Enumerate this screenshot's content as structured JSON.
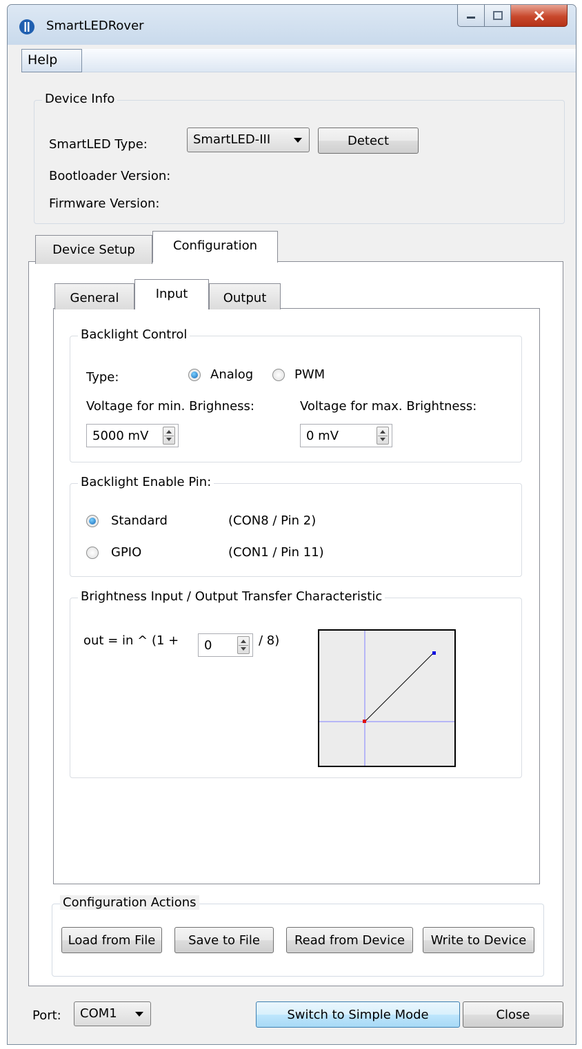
{
  "window": {
    "title": "SmartLEDRover",
    "icons": {
      "app": "app-logo-icon",
      "minimize": "minimize-icon",
      "maximize": "maximize-icon",
      "close": "close-x-icon"
    }
  },
  "menu": {
    "help": "Help"
  },
  "device_info": {
    "title": "Device Info",
    "type_label": "SmartLED Type:",
    "type_value": "SmartLED-III",
    "detect": "Detect",
    "bootloader_label": "Bootloader Version:",
    "firmware_label": "Firmware Version:"
  },
  "tabs": {
    "device_setup": "Device Setup",
    "configuration": "Configuration",
    "active": "Configuration"
  },
  "subtabs": {
    "general": "General",
    "input": "Input",
    "output": "Output",
    "active": "Input"
  },
  "backlight_control": {
    "title": "Backlight Control",
    "type_label": "Type:",
    "analog": "Analog",
    "pwm": "PWM",
    "selected": "Analog",
    "min_label": "Voltage for min. Brighness:",
    "max_label": "Voltage for max. Brightness:",
    "min_value": "5000 mV",
    "max_value": "0 mV"
  },
  "enable_pin": {
    "title": "Backlight Enable Pin:",
    "standard": "Standard",
    "standard_pin": "(CON8 / Pin 2)",
    "gpio": "GPIO",
    "gpio_pin": "(CON1 / Pin 11)",
    "selected": "Standard"
  },
  "transfer": {
    "title": "Brightness Input / Output Transfer Characteristic",
    "formula_prefix": "out = in ^ (1 +",
    "formula_suffix": "/ 8)",
    "exponent_value": "0"
  },
  "config_actions": {
    "title": "Configuration Actions",
    "load": "Load from File",
    "save": "Save to File",
    "read": "Read from Device",
    "write": "Write to Device"
  },
  "footer": {
    "port_label": "Port:",
    "port_value": "COM1",
    "switch_mode": "Switch to Simple Mode",
    "close": "Close"
  },
  "colors": {
    "axis_line": "#8080ff",
    "curve": "#000000",
    "start_point": "#e01010",
    "end_point": "#1010e0"
  }
}
